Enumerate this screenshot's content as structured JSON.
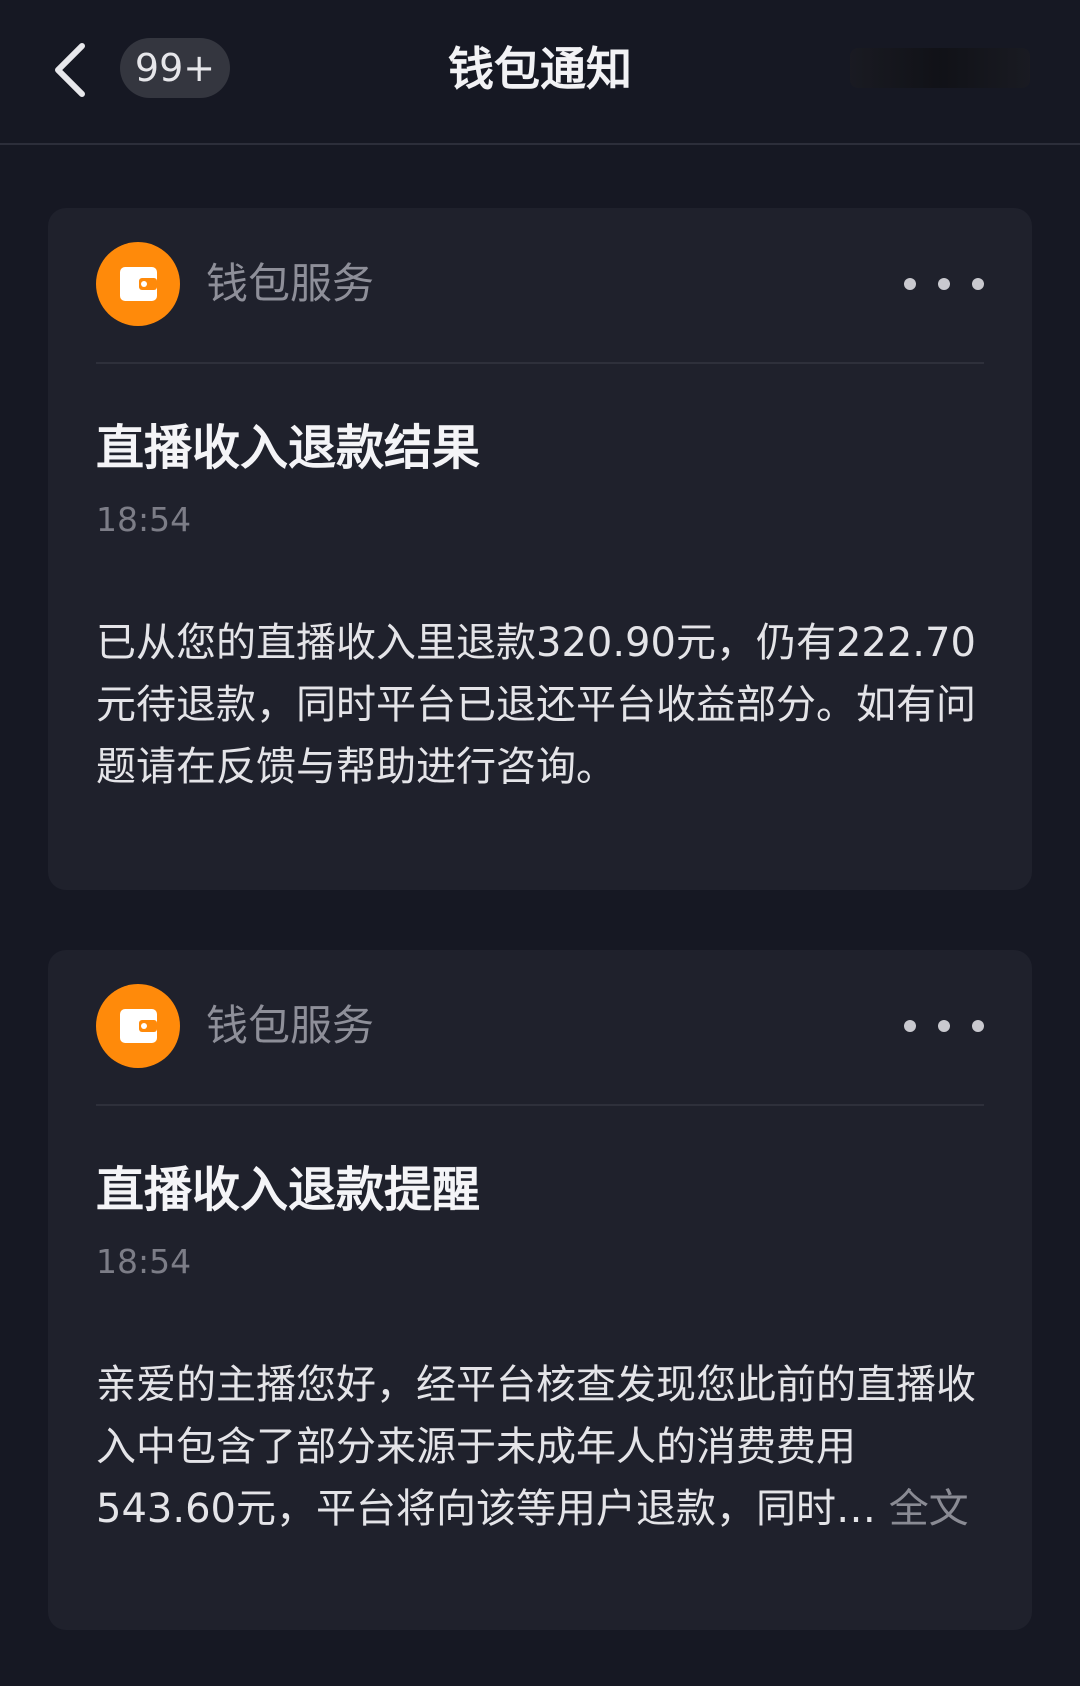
{
  "header": {
    "title": "钱包通知",
    "badge": "99+",
    "icons": {
      "back": "chevron-left-icon"
    }
  },
  "notifications": [
    {
      "sender": "钱包服务",
      "title": "直播收入退款结果",
      "time": "18:54",
      "body": "已从您的直播收入里退款320.90元，仍有222.70元待退款，同时平台已退还平台收益部分。如有问题请在反馈与帮助进行咨询。",
      "read_more": ""
    },
    {
      "sender": "钱包服务",
      "title": "直播收入退款提醒",
      "time": "18:54",
      "body": "亲爱的主播您好，经平台核查发现您此前的直播收入中包含了部分来源于未成年人的消费费用543.60元，平台将向该等用户退款，同时…",
      "read_more": "全文"
    }
  ],
  "colors": {
    "background": "#161823",
    "card": "#1f212c",
    "accent": "#ff8a0a"
  }
}
